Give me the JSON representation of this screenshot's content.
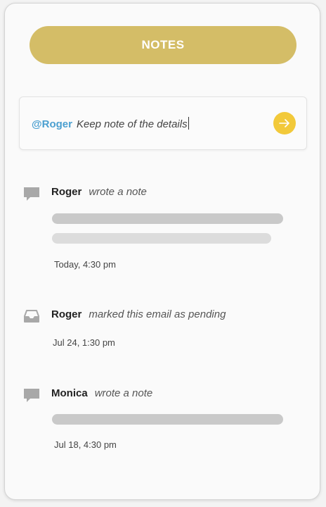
{
  "header": {
    "button_label": "NOTES"
  },
  "composer": {
    "mention": "@Roger",
    "message": "Keep note of the details",
    "send_icon": "arrow-right-icon"
  },
  "activity": [
    {
      "icon": "comment-icon",
      "name": "Roger",
      "action": "wrote a note",
      "timestamp": "Today, 4:30 pm"
    },
    {
      "icon": "inbox-icon",
      "name": "Roger",
      "action": "marked this email as pending",
      "timestamp": "Jul 24, 1:30 pm"
    },
    {
      "icon": "comment-icon",
      "name": "Monica",
      "action": "wrote a note",
      "timestamp": "Jul 18, 4:30 pm"
    }
  ],
  "colors": {
    "accent": "#d4bd67",
    "send_button": "#f2c93a",
    "mention": "#4a9fd0",
    "placeholder_bar": "#c8c8c8"
  }
}
